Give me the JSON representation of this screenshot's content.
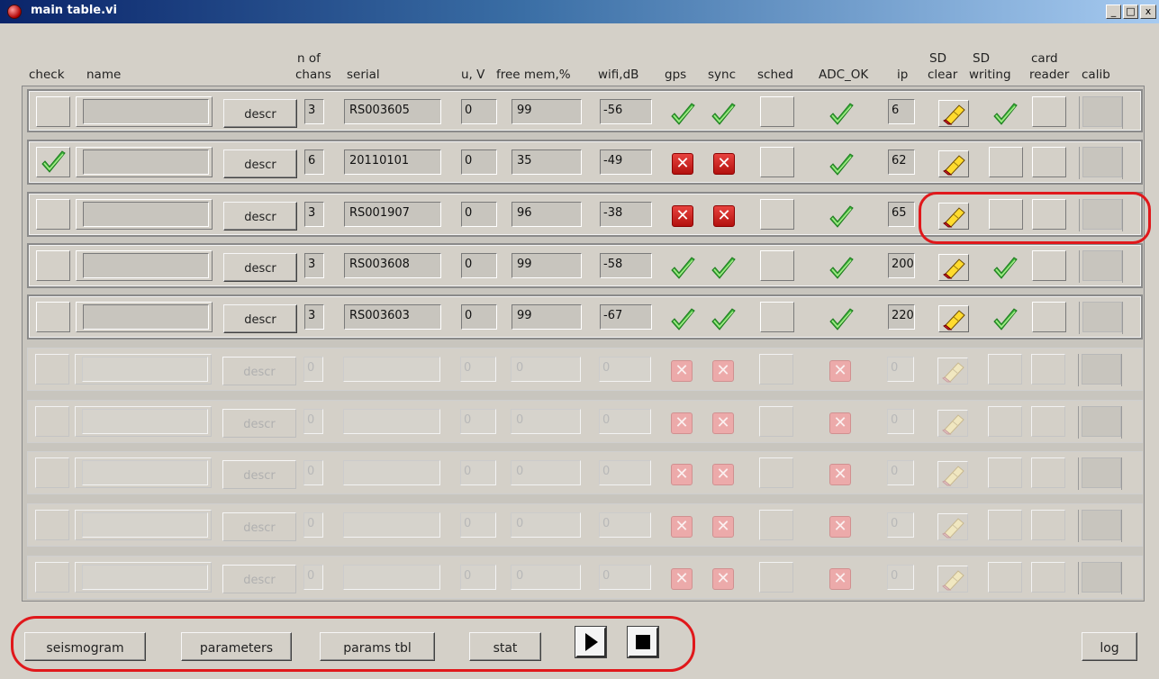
{
  "window": {
    "title": "main table.vi",
    "min": "_",
    "max": "□",
    "close": "x"
  },
  "headers": {
    "check": "check",
    "name": "name",
    "n_of": "n of",
    "chans": "chans",
    "serial": "serial",
    "u_v": "u, V",
    "free_mem": "free mem,%",
    "wifi": "wifi,dB",
    "gps": "gps",
    "sync": "sync",
    "sched": "sched",
    "adc_ok": "ADC_OK",
    "ip": "ip",
    "sd_clear_1": "SD",
    "sd_clear_2": "clear",
    "sd_writing_1": "SD",
    "sd_writing_2": "writing",
    "card_reader_1": "card",
    "card_reader_2": "reader",
    "calib": "calib"
  },
  "rows": [
    {
      "active": true,
      "check": false,
      "name": "",
      "descr": "descr",
      "chans": "3",
      "serial": "RS003605",
      "u": "0",
      "mem": "99",
      "wifi": "-56",
      "gps": "ok",
      "sync": "ok",
      "adc": "ok",
      "ip": "6",
      "sd_writing": true
    },
    {
      "active": true,
      "check": true,
      "name": "",
      "descr": "descr",
      "chans": "6",
      "serial": "20110101",
      "u": "0",
      "mem": "35",
      "wifi": "-49",
      "gps": "fail",
      "sync": "fail",
      "adc": "ok",
      "ip": "62",
      "sd_writing": false
    },
    {
      "active": true,
      "check": false,
      "name": "",
      "descr": "descr",
      "chans": "3",
      "serial": "RS001907",
      "u": "0",
      "mem": "96",
      "wifi": "-38",
      "gps": "fail",
      "sync": "fail",
      "adc": "ok",
      "ip": "65",
      "sd_writing": false
    },
    {
      "active": true,
      "check": false,
      "name": "",
      "descr": "descr",
      "chans": "3",
      "serial": "RS003608",
      "u": "0",
      "mem": "99",
      "wifi": "-58",
      "gps": "ok",
      "sync": "ok",
      "adc": "ok",
      "ip": "200",
      "sd_writing": true
    },
    {
      "active": true,
      "check": false,
      "name": "",
      "descr": "descr",
      "chans": "3",
      "serial": "RS003603",
      "u": "0",
      "mem": "99",
      "wifi": "-67",
      "gps": "ok",
      "sync": "ok",
      "adc": "ok",
      "ip": "220",
      "sd_writing": true
    },
    {
      "active": false,
      "check": false,
      "name": "",
      "descr": "descr",
      "chans": "0",
      "serial": "",
      "u": "0",
      "mem": "0",
      "wifi": "0",
      "gps": "fail",
      "sync": "fail",
      "adc": "fail",
      "ip": "0",
      "sd_writing": false
    },
    {
      "active": false,
      "check": false,
      "name": "",
      "descr": "descr",
      "chans": "0",
      "serial": "",
      "u": "0",
      "mem": "0",
      "wifi": "0",
      "gps": "fail",
      "sync": "fail",
      "adc": "fail",
      "ip": "0",
      "sd_writing": false
    },
    {
      "active": false,
      "check": false,
      "name": "",
      "descr": "descr",
      "chans": "0",
      "serial": "",
      "u": "0",
      "mem": "0",
      "wifi": "0",
      "gps": "fail",
      "sync": "fail",
      "adc": "fail",
      "ip": "0",
      "sd_writing": false
    },
    {
      "active": false,
      "check": false,
      "name": "",
      "descr": "descr",
      "chans": "0",
      "serial": "",
      "u": "0",
      "mem": "0",
      "wifi": "0",
      "gps": "fail",
      "sync": "fail",
      "adc": "fail",
      "ip": "0",
      "sd_writing": false
    },
    {
      "active": false,
      "check": false,
      "name": "",
      "descr": "descr",
      "chans": "0",
      "serial": "",
      "u": "0",
      "mem": "0",
      "wifi": "0",
      "gps": "fail",
      "sync": "fail",
      "adc": "fail",
      "ip": "0",
      "sd_writing": false
    }
  ],
  "buttons": {
    "seismogram": "seismogram",
    "parameters": "parameters",
    "params_tbl": "params tbl",
    "stat": "stat",
    "log": "log"
  },
  "icons": {
    "run": "play-icon",
    "stop": "stop-icon",
    "check": "checkmark-icon",
    "fail": "x-mark-icon",
    "sd_clear": "eraser-icon"
  },
  "colors": {
    "background": "#d4d0c8",
    "titlebar": "#0a246a",
    "highlight": "#e0181b",
    "check_green": "#3cb33c",
    "fail_red": "#cc1a16"
  }
}
